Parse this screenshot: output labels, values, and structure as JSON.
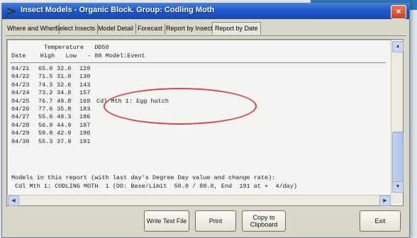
{
  "window": {
    "title": "Insect Models - Organic Block. Group: Codling Moth",
    "close_glyph": "×"
  },
  "tabs": [
    {
      "label": "Where and When"
    },
    {
      "label": "Select Insects"
    },
    {
      "label": "Model Detail"
    },
    {
      "label": "Forecast"
    },
    {
      "label": "Report by Insect"
    },
    {
      "label": "Report by Date"
    }
  ],
  "active_tab": "Report by Date",
  "report": {
    "header_line1": "         Temperature   DD50",
    "header_line2": "Date    High   Low   - 88 Model:Event",
    "rows": [
      {
        "date": "04/21",
        "high": "65.0",
        "low": "32.0",
        "dd": "120",
        "event": ""
      },
      {
        "date": "04/22",
        "high": "71.5",
        "low": "31.0",
        "dd": "130",
        "event": ""
      },
      {
        "date": "04/23",
        "high": "74.3",
        "low": "32.6",
        "dd": "143",
        "event": ""
      },
      {
        "date": "04/24",
        "high": "73.2",
        "low": "34.8",
        "dd": "157",
        "event": ""
      },
      {
        "date": "04/25",
        "high": "76.7",
        "low": "49.8",
        "dd": "169",
        "event": "Cdl Mth 1: Egg hatch"
      },
      {
        "date": "04/26",
        "high": "77.6",
        "low": "35.8",
        "dd": "183",
        "event": ""
      },
      {
        "date": "04/27",
        "high": "55.6",
        "low": "49.3",
        "dd": "186",
        "event": ""
      },
      {
        "date": "04/28",
        "high": "56.9",
        "low": "44.9",
        "dd": "187",
        "event": ""
      },
      {
        "date": "04/29",
        "high": "59.8",
        "low": "42.9",
        "dd": "190",
        "event": ""
      },
      {
        "date": "04/30",
        "high": "55.3",
        "low": "37.9",
        "dd": "191",
        "event": ""
      }
    ],
    "footer_line1": "Models in this report (with last day's Degree Day value and change rate):",
    "footer_line2": " Cdl Mth 1: CODLING MOTH  1 (DD: Base/Limit  50.0 / 88.0, End  191 at +  4/day)"
  },
  "buttons": {
    "write_text_file": "Write Text File",
    "print": "Print",
    "copy_to_clipboard_1": "Copy to",
    "copy_to_clipboard_2": "Clipboard",
    "exit": "Exit"
  },
  "colors": {
    "title_bar": "#1f58c8",
    "highlight": "#d8454a",
    "window_face": "#d8d7c8"
  },
  "icons": {
    "app": "moth-app-icon",
    "scroll_up": "arrow-up-icon",
    "scroll_down": "arrow-down-icon",
    "scroll_left": "arrow-left-icon",
    "scroll_right": "arrow-right-icon"
  }
}
